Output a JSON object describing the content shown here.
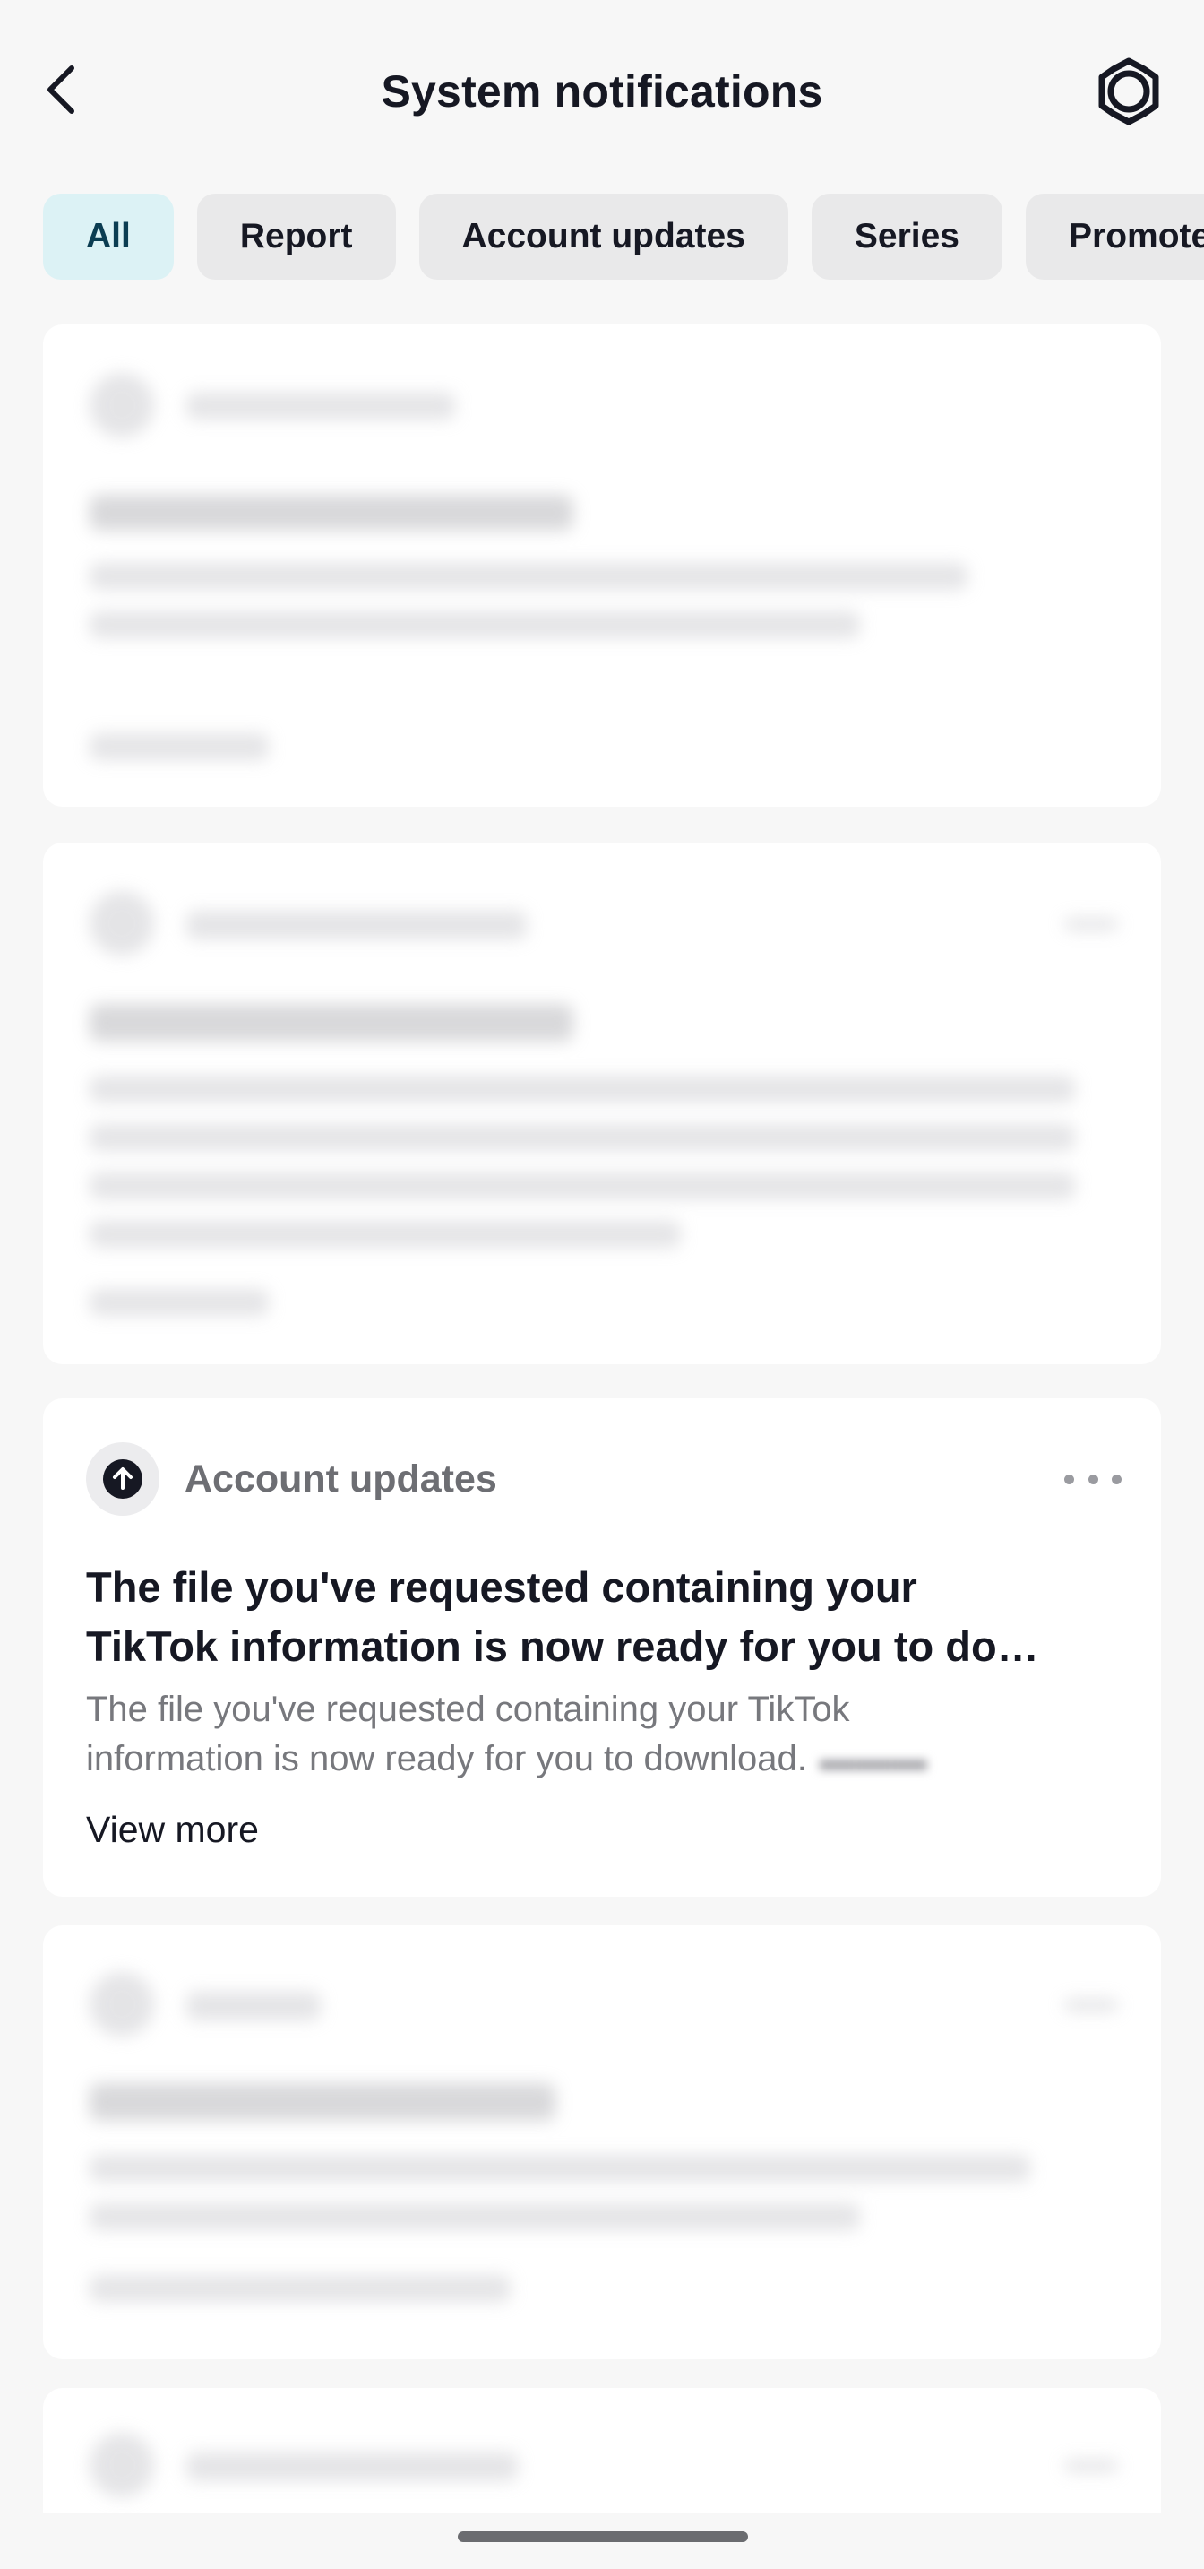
{
  "header": {
    "title": "System notifications",
    "back_icon": "chevron-left-icon",
    "settings_icon": "gear-icon"
  },
  "tabs": [
    {
      "label": "All",
      "active": true
    },
    {
      "label": "Report",
      "active": false
    },
    {
      "label": "Account updates",
      "active": false
    },
    {
      "label": "Series",
      "active": false
    },
    {
      "label": "Promote",
      "active": false
    }
  ],
  "focused_card": {
    "category": "Account updates",
    "category_icon": "upload-arrow-icon",
    "title_line1": "The file you've requested containing your",
    "title_line2": "TikTok information is now ready for you to do…",
    "body_line1": "The file you've requested containing your TikTok",
    "body_line2": "information is now ready for you to download.",
    "view_more": "View more"
  },
  "colors": {
    "background": "#f7f7f7",
    "card": "#ffffff",
    "active_tab_bg": "#dcf2f5",
    "inactive_tab_bg": "#e9e9ea",
    "text_primary": "#161823",
    "text_secondary": "#77787d"
  }
}
